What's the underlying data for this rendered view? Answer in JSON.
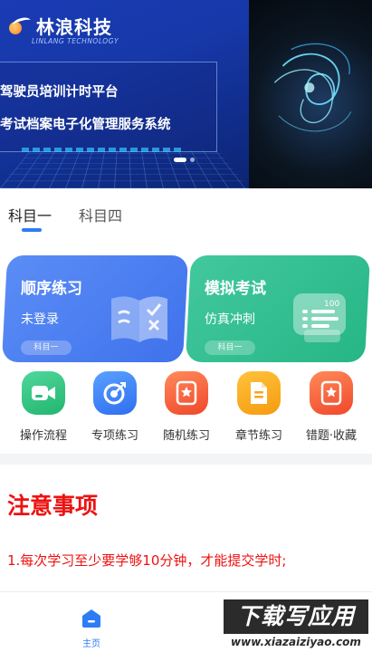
{
  "banner": {
    "brand_name": "林浪科技",
    "brand_sub": "LINLANG TECHNOLOGY",
    "line1": "驾驶员培训计时平台",
    "line2": "考试档案电子化管理服务系统",
    "icon_logo": "linlang-logo-icon",
    "accent": "#33c6ff"
  },
  "tabs": [
    {
      "label": "科目一",
      "active": true
    },
    {
      "label": "科目四",
      "active": false
    }
  ],
  "cards": [
    {
      "title": "顺序练习",
      "subtitle": "未登录",
      "tag": "科目一",
      "color": "#4a7ef0",
      "icon": "open-book-icon"
    },
    {
      "title": "模拟考试",
      "subtitle": "仿真冲刺",
      "tag": "科目一",
      "color": "#2fbd8e",
      "icon": "exam-paper-icon"
    }
  ],
  "actions": [
    {
      "label": "操作流程",
      "icon": "video-camera-icon",
      "color": "#2dbf7a"
    },
    {
      "label": "专项练习",
      "icon": "target-icon",
      "color": "#3b7cf3"
    },
    {
      "label": "随机练习",
      "icon": "star-card-icon",
      "color": "#f25a33"
    },
    {
      "label": "章节练习",
      "icon": "document-icon",
      "color": "#f7a51d"
    },
    {
      "label": "错题·收藏",
      "icon": "star-card-icon",
      "color": "#f25a33"
    }
  ],
  "notice": {
    "title": "注意事项",
    "items": [
      "1.每次学习至少要学够10分钟，才能提交学时;"
    ],
    "color": "#ee1111"
  },
  "nav": {
    "home_label": "主页",
    "home_icon": "home-icon",
    "active_color": "#2d7cf6"
  },
  "watermark": {
    "main": "下载写应用",
    "url": "www.xiazaiziyao.com"
  }
}
